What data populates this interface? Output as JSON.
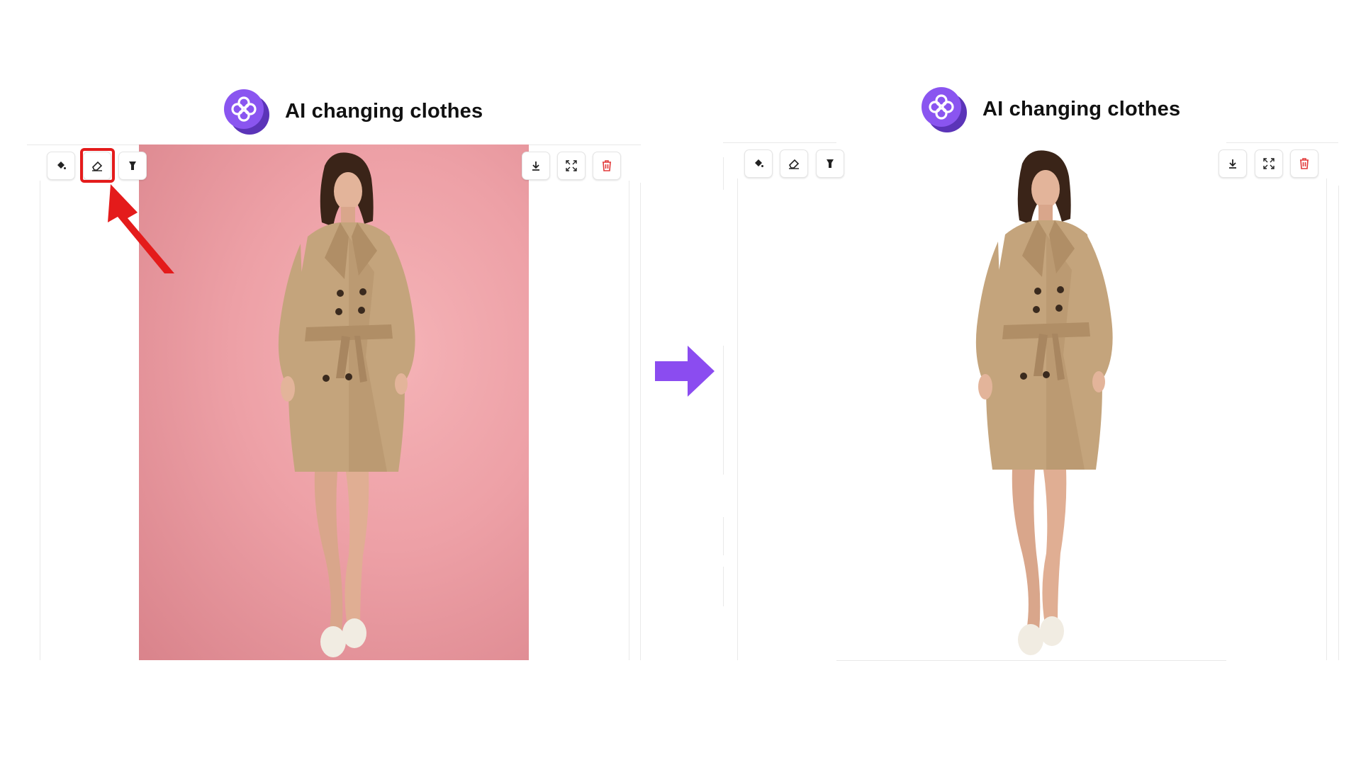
{
  "left_panel": {
    "title": "AI changing clothes",
    "toolbar_left": [
      {
        "icon": "paint-bucket-icon",
        "label": "paint-bucket"
      },
      {
        "icon": "eraser-icon",
        "label": "eraser",
        "highlighted": true
      },
      {
        "icon": "flashlight-icon",
        "label": "flashlight"
      }
    ],
    "toolbar_right": [
      {
        "icon": "download-icon"
      },
      {
        "icon": "fullscreen-icon"
      },
      {
        "icon": "delete-icon",
        "color": "#e23a3a"
      }
    ],
    "image_background": "pink"
  },
  "right_panel": {
    "title": "AI changing clothes",
    "toolbar_left": [
      {
        "icon": "paint-bucket-icon"
      },
      {
        "icon": "eraser-icon"
      },
      {
        "icon": "flashlight-icon"
      }
    ],
    "toolbar_right": [
      {
        "icon": "download-icon"
      },
      {
        "icon": "fullscreen-icon"
      },
      {
        "icon": "delete-icon",
        "color": "#e23a3a"
      }
    ],
    "image_background": "transparent"
  },
  "colors": {
    "brand_purple": "#8a55f0",
    "arrow_purple": "#8b4cf0",
    "highlight_red": "#e41b1b",
    "pink_background": "#efa4a9"
  }
}
